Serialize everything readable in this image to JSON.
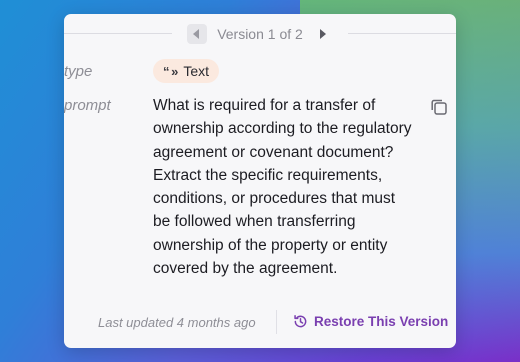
{
  "version_nav": {
    "label": "Version 1 of 2",
    "prev_icon": "chevron-left-icon",
    "next_icon": "chevron-right-icon"
  },
  "fields": {
    "type_label": "type",
    "type_value": "Text",
    "type_icon": "quote-icon",
    "prompt_label": "prompt",
    "prompt_text": "What is required for a transfer of ownership according to the regulatory agreement or covenant document? Extract the specific requirements, conditions, or procedures that must be followed when transferring ownership of the property or entity covered by the agreement."
  },
  "footer": {
    "last_updated": "Last updated 4 months ago",
    "restore_label": "Restore This Version",
    "restore_icon": "history-icon"
  },
  "colors": {
    "accent": "#7a3fb0",
    "badge_bg": "#fbe9df",
    "card_bg": "#f7f7f9"
  }
}
